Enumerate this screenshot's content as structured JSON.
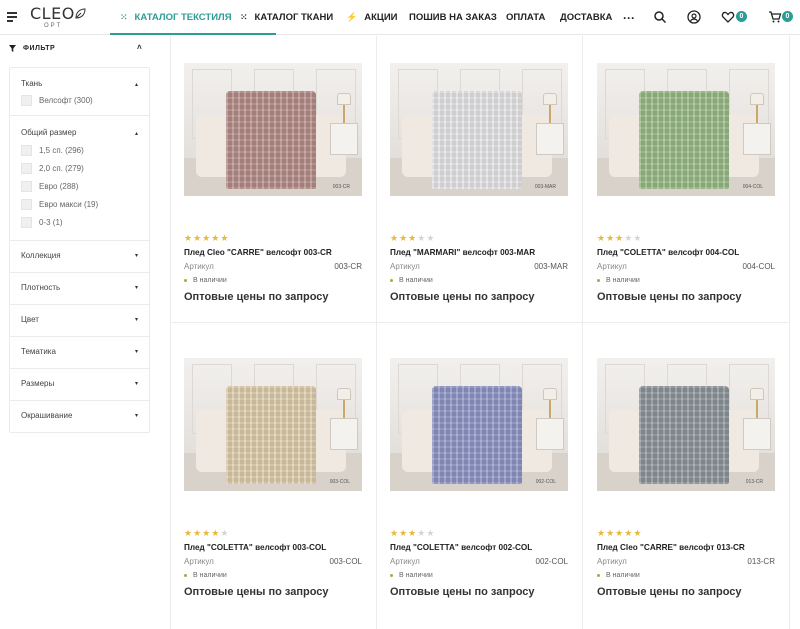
{
  "header": {
    "logo_text": "CLEO",
    "logo_sub": "OPT",
    "nav": [
      {
        "label": "КАТАЛОГ ТЕКСТИЛЯ",
        "active": true
      },
      {
        "label": "КАТАЛОГ ТКАНИ"
      },
      {
        "label": "АКЦИИ"
      },
      {
        "label": "ПОШИВ НА ЗАКАЗ"
      },
      {
        "label": "ОПЛАТА"
      },
      {
        "label": "ДОСТАВКА"
      }
    ],
    "wishlist_count": "0",
    "cart_count": "0",
    "accent_color": "#2c9c94"
  },
  "filter": {
    "title": "ФИЛЬТР",
    "groups": [
      {
        "title": "Ткань",
        "options": [
          "Велсофт (300)"
        ]
      },
      {
        "title": "Общий размер",
        "options": [
          "1,5 сп. (296)",
          "2,0 сп. (279)",
          "Евро (288)",
          "Евро макси (19)",
          "0-3 (1)"
        ]
      },
      {
        "title": "Коллекция"
      },
      {
        "title": "Плотность"
      },
      {
        "title": "Цвет"
      },
      {
        "title": "Тематика"
      },
      {
        "title": "Размеры"
      },
      {
        "title": "Окрашивание"
      }
    ]
  },
  "products": [
    {
      "name": "Плед Cleo \"CARRE\" велсофт 003-CR",
      "article_label": "Артикул",
      "article": "003-CR",
      "stock": "В наличии",
      "price": "Оптовые цены по запросу",
      "rating": 5,
      "blanket_color": "#b48c88",
      "photo_mark": "003-CR"
    },
    {
      "name": "Плед \"MARMARI\" велсофт 003-MAR",
      "article_label": "Артикул",
      "article": "003-MAR",
      "stock": "В наличии",
      "price": "Оптовые цены по запросу",
      "rating": 3,
      "blanket_color": "#e4e4e6",
      "photo_mark": "003-MAR"
    },
    {
      "name": "Плед \"COLETTA\" велсофт 004-COL",
      "article_label": "Артикул",
      "article": "004-COL",
      "stock": "В наличии",
      "price": "Оптовые цены по запросу",
      "rating": 3,
      "blanket_color": "#97b884",
      "photo_mark": "004-COL"
    },
    {
      "name": "Плед \"COLETTA\" велсофт 003-COL",
      "article_label": "Артикул",
      "article": "003-COL",
      "stock": "В наличии",
      "price": "Оптовые цены по запросу",
      "rating": 4,
      "blanket_color": "#dccbaa",
      "photo_mark": "003-COL"
    },
    {
      "name": "Плед \"COLETTA\" велсофт 002-COL",
      "article_label": "Артикул",
      "article": "002-COL",
      "stock": "В наличии",
      "price": "Оптовые цены по запросу",
      "rating": 3,
      "blanket_color": "#8d93c4",
      "photo_mark": "002-COL"
    },
    {
      "name": "Плед Cleo \"CARRE\" велсофт 013-CR",
      "article_label": "Артикул",
      "article": "013-CR",
      "stock": "В наличии",
      "price": "Оптовые цены по запросу",
      "rating": 5,
      "blanket_color": "#8c949a",
      "photo_mark": "013-CR"
    }
  ]
}
